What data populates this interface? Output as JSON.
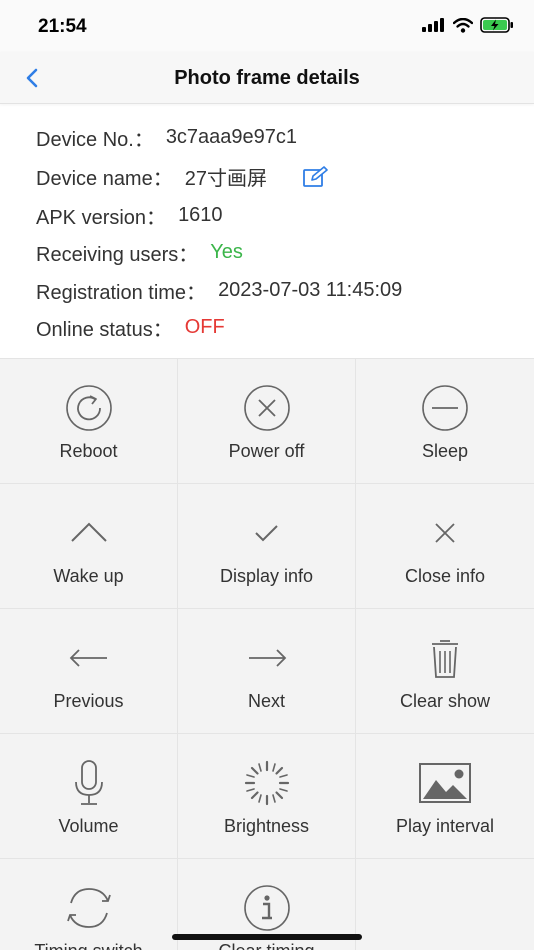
{
  "status_bar": {
    "time": "21:54"
  },
  "nav": {
    "title": "Photo frame details"
  },
  "info": {
    "device_no_label": "Device No.：",
    "device_no": "3c7aaa9e97c1",
    "device_name_label": "Device name：",
    "device_name": "27寸画屏",
    "apk_label": "APK version：",
    "apk": "1610",
    "receiving_label": "Receiving users：",
    "receiving": "Yes",
    "reg_label": "Registration time：",
    "reg": "2023-07-03 11:45:09",
    "online_label": "Online status：",
    "online": "OFF"
  },
  "actions": [
    {
      "label": "Reboot",
      "icon": "reboot-icon"
    },
    {
      "label": "Power off",
      "icon": "power-off-icon"
    },
    {
      "label": "Sleep",
      "icon": "sleep-icon"
    },
    {
      "label": "Wake up",
      "icon": "wake-up-icon"
    },
    {
      "label": "Display info",
      "icon": "check-icon"
    },
    {
      "label": "Close info",
      "icon": "close-icon"
    },
    {
      "label": "Previous",
      "icon": "arrow-left-icon"
    },
    {
      "label": "Next",
      "icon": "arrow-right-icon"
    },
    {
      "label": "Clear show",
      "icon": "trash-icon"
    },
    {
      "label": "Volume",
      "icon": "microphone-icon"
    },
    {
      "label": "Brightness",
      "icon": "brightness-icon"
    },
    {
      "label": "Play interval",
      "icon": "image-icon"
    },
    {
      "label": "Timing switch",
      "icon": "refresh-icon"
    },
    {
      "label": "Clear timing",
      "icon": "info-icon"
    }
  ],
  "colors": {
    "accent": "#2f7ee6",
    "green": "#3bb54a",
    "red": "#e53935",
    "icon_gray": "#666666"
  }
}
